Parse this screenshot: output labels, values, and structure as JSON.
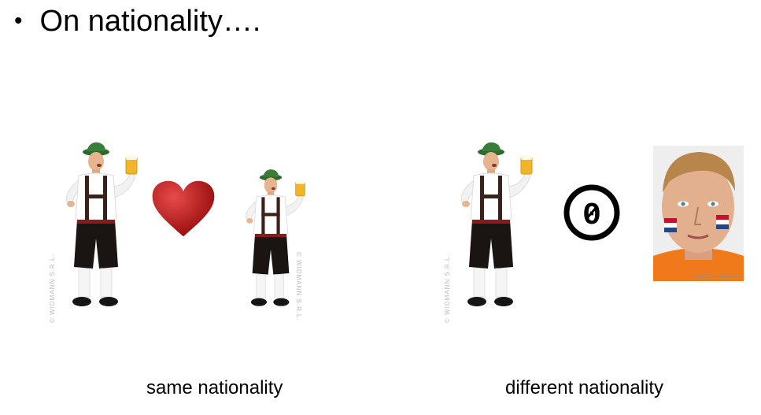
{
  "slide": {
    "bullet": "•",
    "title": "On nationality…."
  },
  "left_group": {
    "caption": "same nationality",
    "watermark_1": "© WIDMANN S.R.L.",
    "watermark_2": "© WIDMANN S.R.L.",
    "symbol": "heart-icon"
  },
  "right_group": {
    "caption": "different nationality",
    "watermark": "© WIDMANN S.R.L.",
    "symbol": "zero-in-circle-icon",
    "symbol_text": "0",
    "photo_credit": "dreamstime.com"
  },
  "colors": {
    "heart": "#c41a1a",
    "shirt_orange": "#f07a1a",
    "flag_red": "#c8102e",
    "flag_blue": "#21468b"
  }
}
